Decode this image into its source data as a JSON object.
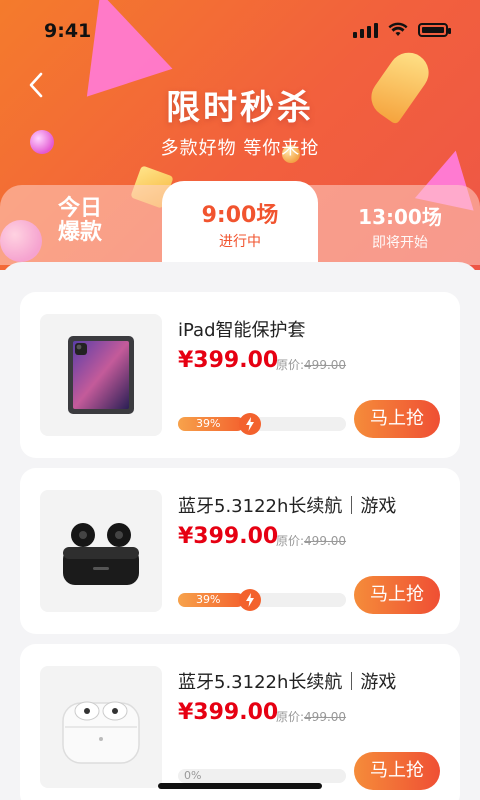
{
  "status_bar": {
    "time": "9:41"
  },
  "header": {
    "title": "限时秒杀",
    "subtitle": "多款好物 等你来抢"
  },
  "tabs": [
    {
      "line1": "今日",
      "line2": "爆款",
      "active": false
    },
    {
      "time": "9:00场",
      "status": "进行中",
      "active": true
    },
    {
      "time": "13:00场",
      "status": "即将开始",
      "active": false
    }
  ],
  "products": [
    {
      "name": "iPad智能保护套",
      "price": "¥399.00",
      "orig_label": "原价:",
      "orig_price": "499.00",
      "progress_text": "39%",
      "progress": 0.39,
      "buy_label": "马上抢",
      "image": "ipad"
    },
    {
      "name": "蓝牙5.3122h长续航｜游戏",
      "price": "¥399.00",
      "orig_label": "原价:",
      "orig_price": "499.00",
      "progress_text": "39%",
      "progress": 0.39,
      "buy_label": "马上抢",
      "image": "earbuds-black"
    },
    {
      "name": "蓝牙5.3122h长续航｜游戏",
      "price": "¥399.00",
      "orig_label": "原价:",
      "orig_price": "499.00",
      "progress_text": "0%",
      "progress": 0,
      "buy_label": "马上抢",
      "image": "airpods"
    }
  ],
  "colors": {
    "accent": "#f1542f",
    "price": "#e60012"
  }
}
